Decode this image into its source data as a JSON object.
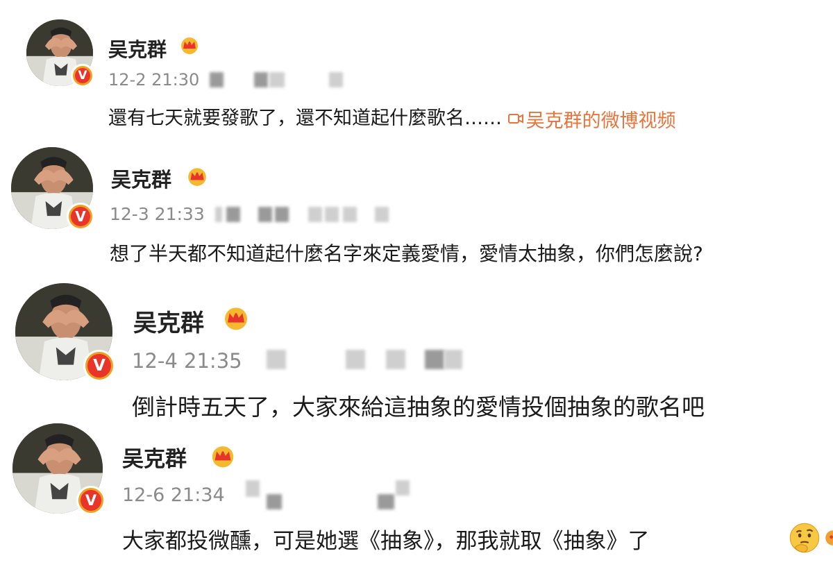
{
  "posts": [
    {
      "username": "吴克群",
      "timestamp": "12-2 21:30",
      "text": "還有七天就要發歌了，還不知道起什麼歌名……",
      "video_link": "吴克群的微博视频"
    },
    {
      "username": "吴克群",
      "timestamp": "12-3 21:33",
      "text": "想了半天都不知道起什麼名字來定義愛情，愛情太抽象，你們怎麼說?"
    },
    {
      "username": "吴克群",
      "timestamp": "12-4 21:35",
      "text": "倒計時五天了，大家來給這抽象的愛情投個抽象的歌名吧"
    },
    {
      "username": "吴克群",
      "timestamp": "12-6 21:34",
      "text": "大家都投微醺，可是她選《抽象》，那我就取《抽象》了"
    }
  ],
  "icons": {
    "verified": "verified-v-icon",
    "crown": "crown-icon",
    "video": "video-icon",
    "thinking_emoji": "thinking-emoji-icon"
  },
  "colors": {
    "link": "#e8743b",
    "verified_badge": "#e8342a",
    "crown": "#f5b82e",
    "meta": "#8a8a8a"
  }
}
